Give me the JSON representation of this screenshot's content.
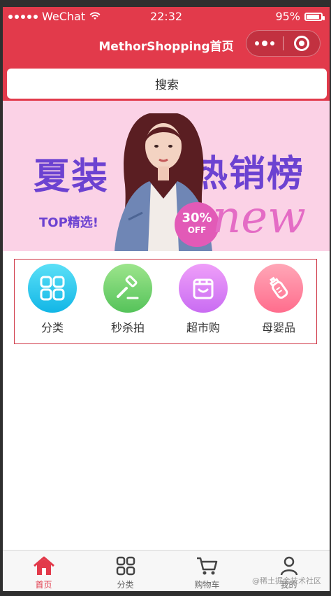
{
  "status": {
    "carrier": "WeChat",
    "time": "22:32",
    "battery": "95%"
  },
  "nav": {
    "title": "MethorShopping首页"
  },
  "search": {
    "label": "搜索"
  },
  "banner": {
    "left_text": "夏装",
    "right_text": "热销榜",
    "sub_text": "TOP精选!",
    "badge_pct": "30%",
    "badge_off": "OFF",
    "script_text": "new",
    "dots": 3,
    "active_dot": 0
  },
  "categories": [
    {
      "label": "分类",
      "color": "#23c7ee",
      "icon": "grid-icon"
    },
    {
      "label": "秒杀拍",
      "color": "#6ccf6c",
      "icon": "gavel-icon"
    },
    {
      "label": "超市购",
      "color": "#d97cf6",
      "icon": "store-icon"
    },
    {
      "label": "母婴品",
      "color": "#ff7f9b",
      "icon": "bottle-icon"
    }
  ],
  "tabs": [
    {
      "label": "首页",
      "icon": "home-icon",
      "active": true
    },
    {
      "label": "分类",
      "icon": "grid-icon",
      "active": false
    },
    {
      "label": "购物车",
      "icon": "cart-icon",
      "active": false
    },
    {
      "label": "我的",
      "icon": "user-icon",
      "active": false
    }
  ],
  "watermark": "@稀土掘金技术社区",
  "colors": {
    "brand": "#e23a4b",
    "banner_bg": "#fbd2e6",
    "banner_text": "#6c42d1"
  }
}
